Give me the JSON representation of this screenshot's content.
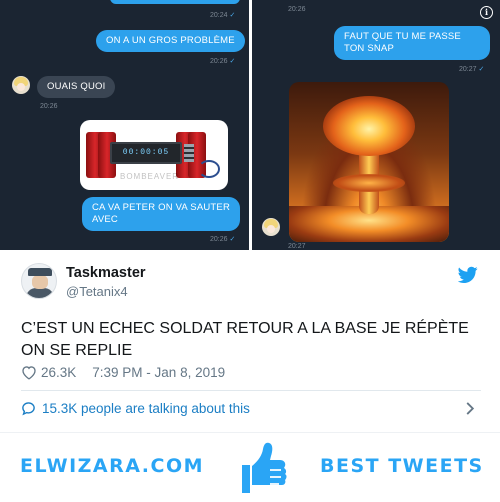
{
  "chat_left": {
    "ts_top": "20:24",
    "msg_problem": "ON A UN GROS PROBLÈME",
    "ts_problem": "20:26",
    "msg_ouais": "OUAIS QUOI",
    "ts_ouais": "20:26",
    "bomb_timer": "00:00:05",
    "bomb_watermark": "BOMBEAVER",
    "msg_peter": "CA VA PETER ON VA SAUTER AVEC",
    "ts_peter": "20:26",
    "check": "✓"
  },
  "chat_right": {
    "ts_top": "20:26",
    "msg_snap": "FAUT QUE TU ME PASSE TON SNAP",
    "ts_snap": "20:27",
    "ts_bottom": "20:27",
    "check": "✓",
    "info_icon": "info-icon"
  },
  "tweet": {
    "name": "Taskmaster",
    "handle": "@Tetanix4",
    "text": "C’EST UN ECHEC SOLDAT RETOUR A LA BASE JE RÉPÈTE ON SE REPLIE",
    "likes": "26.3K",
    "timestamp": "7:39 PM - Jan 8, 2019",
    "talking": "15.3K people are talking about this",
    "brand_color": "#1da1f2",
    "link_color": "#1b7ec4"
  },
  "footer": {
    "site": "ELWIZARA.COM",
    "tagline": "BEST TWEETS",
    "accent": "#2aa5f5"
  }
}
